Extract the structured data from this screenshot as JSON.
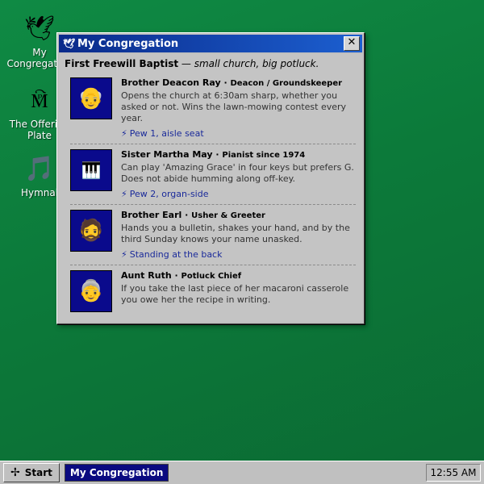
{
  "desktop": {
    "icons": [
      {
        "label": "My Congregation",
        "glyph": "🕊"
      },
      {
        "label": "The Offering Plate",
        "glyph": "🕅"
      },
      {
        "label": "Hymnal",
        "glyph": "🎵"
      }
    ]
  },
  "window": {
    "title": "My Congregation",
    "title_icon": "🕊",
    "close_label": "✕",
    "church_name": "First Freewill Baptist",
    "church_sep": " — ",
    "church_tagline": "small church, big potluck.",
    "members": [
      {
        "name": "Brother Deacon Ray",
        "role": "Deacon / Groundskeeper",
        "avatar": "👴",
        "description": "Opens the church at 6:30am sharp, whether you asked or not. Wins the lawn-mowing contest every year.",
        "seat": "Pew 1, aisle seat"
      },
      {
        "name": "Sister Martha May",
        "role": "Pianist since 1974",
        "avatar": "🎹",
        "description": "Can play 'Amazing Grace' in four keys but prefers G. Does not abide humming along off-key.",
        "seat": "Pew 2, organ-side"
      },
      {
        "name": "Brother Earl",
        "role": "Usher & Greeter",
        "avatar": "🧔",
        "description": "Hands you a bulletin, shakes your hand, and by the third Sunday knows your name unasked.",
        "seat": "Standing at the back"
      },
      {
        "name": "Aunt Ruth",
        "role": "Potluck Chief",
        "avatar": "👵",
        "description": "If you take the last piece of her macaroni casserole you owe her the recipe in writing.",
        "seat": ""
      }
    ]
  },
  "taskbar": {
    "start_label": "Start",
    "start_icon": "✢",
    "task_label": "My Congregation",
    "clock": "12:55 AM"
  },
  "colors": {
    "desktop": "#0c7a3a",
    "titlebar": "#0a2a8a",
    "avatar_bg": "#0a0a8c",
    "seat_link": "#1a2a9a"
  }
}
